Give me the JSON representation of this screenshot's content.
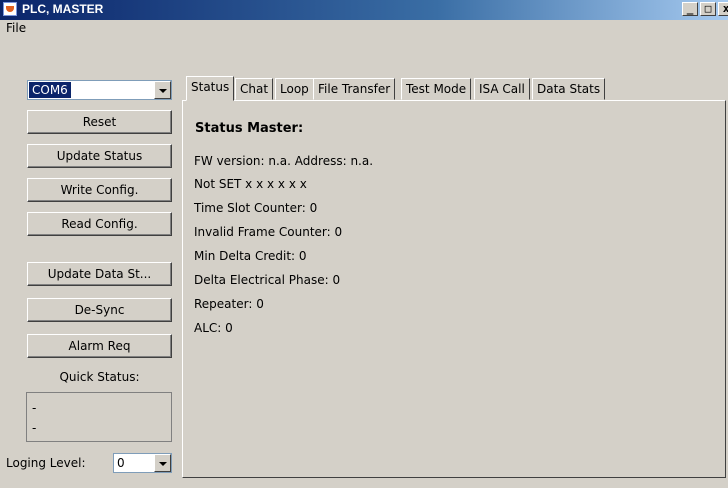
{
  "window": {
    "title": "PLC, MASTER",
    "controls": [
      "_",
      "□",
      "x"
    ]
  },
  "menu": {
    "file": "File"
  },
  "left": {
    "com_port": "COM6",
    "buttons": {
      "reset": "Reset",
      "update_status": "Update Status",
      "write_config": "Write Config.",
      "read_config": "Read Config.",
      "update_data": "Update Data St...",
      "desync": "De-Sync",
      "alarm": "Alarm Req"
    },
    "quick_status_label": "Quick Status:",
    "quick_status_lines": [
      "-",
      "-"
    ],
    "logging_label": "Loging Level:",
    "logging_value": "0"
  },
  "tabs": [
    "Status",
    "Chat",
    "Loop",
    "File Transfer",
    "Test Mode",
    "ISA Call",
    "Data Stats"
  ],
  "status": {
    "title": "Status Master:",
    "fw_version": "FW version:  n.a.  Address: n.a.",
    "not_set": "Not SET  x  x  x  x  x  x",
    "time_slot": "Time Slot Counter:  0",
    "invalid_frame": "Invalid Frame Counter:  0",
    "min_delta": "Min Delta Credit:  0",
    "delta_phase": "Delta Electrical Phase:  0",
    "repeater": "Repeater:  0",
    "alc": "ALC:  0"
  }
}
